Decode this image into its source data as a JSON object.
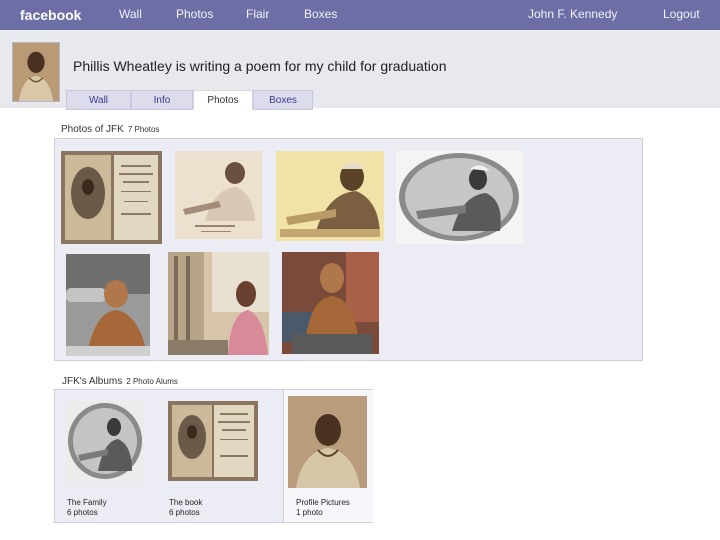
{
  "topbar": {
    "logo": "facebook",
    "nav": [
      "Wall",
      "Photos",
      "Flair",
      "Boxes"
    ],
    "user": "John F. Kennedy",
    "logout": "Logout"
  },
  "profile": {
    "status": "Phillis Wheatley is writing a poem for my child for graduation"
  },
  "tabs": [
    {
      "label": "Wall"
    },
    {
      "label": "Info"
    },
    {
      "label": "Photos",
      "active": true
    },
    {
      "label": "Boxes"
    }
  ],
  "photos_section": {
    "title": "Photos of JFK",
    "count": "7 Photos",
    "photos": [
      "book-frontispiece",
      "engraving-sketch",
      "sepia-engraving",
      "oval-portrait",
      "statue-bronze",
      "painting-sidewalk",
      "statue-memorial"
    ]
  },
  "albums_section": {
    "title": "JFK's Albums",
    "count": "2 Photo Alums",
    "albums": [
      {
        "name": "The Family",
        "count": "6 photos"
      },
      {
        "name": "The book",
        "count": "6 photos"
      },
      {
        "name": "Profile Pictures",
        "count": "1 photo"
      }
    ]
  },
  "colors": {
    "topbar": "#6d6ea6",
    "header_bg": "#e8e8ef",
    "panel_bg": "#ecedf4"
  }
}
